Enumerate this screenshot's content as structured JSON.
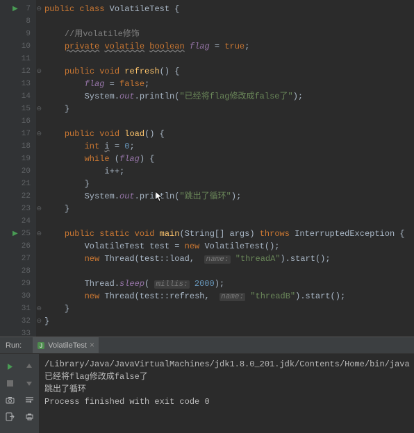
{
  "editor": {
    "lines": [
      {
        "n": 7,
        "run": true,
        "fold": "-"
      },
      {
        "n": 8
      },
      {
        "n": 9
      },
      {
        "n": 10
      },
      {
        "n": 11
      },
      {
        "n": 12,
        "fold": "-"
      },
      {
        "n": 13
      },
      {
        "n": 14
      },
      {
        "n": 15,
        "fold": "e"
      },
      {
        "n": 16
      },
      {
        "n": 17,
        "fold": "-"
      },
      {
        "n": 18
      },
      {
        "n": 19
      },
      {
        "n": 20
      },
      {
        "n": 21
      },
      {
        "n": 22
      },
      {
        "n": 23,
        "fold": "e"
      },
      {
        "n": 24
      },
      {
        "n": 25,
        "run": true,
        "fold": "-"
      },
      {
        "n": 26
      },
      {
        "n": 27
      },
      {
        "n": 28
      },
      {
        "n": 29
      },
      {
        "n": 30
      },
      {
        "n": 31,
        "fold": "e"
      },
      {
        "n": 32,
        "fold": "e"
      },
      {
        "n": 33
      }
    ],
    "tokens": {
      "public": "public",
      "class": "class",
      "className": "VolatileTest",
      "lb": "{",
      "rb": "}",
      "comment9": "//用volatile修饰",
      "private": "private",
      "volatile": "volatile",
      "boolean": "boolean",
      "flag": "flag",
      "eq": " = ",
      "true": "true",
      "semi": ";",
      "void": "void",
      "refresh": "refresh",
      "lp": "(",
      "rp": ")",
      "false": "false",
      "System": "System",
      "out": "out",
      "println": "println",
      "dot": ".",
      "str14": "\"已经将flag修改成false了\"",
      "load": "load",
      "int": "int",
      "i": "i",
      "zero": "0",
      "while": "while",
      "ipp": "i++;",
      "str22": "\"跳出了循环\"",
      "static": "static",
      "main": "main",
      "StringArr": "String[]",
      "args": "args",
      "throws": "throws",
      "IE": "InterruptedException",
      "test": "test",
      "new": "new",
      "Thread": "Thread",
      "dcolon": "::",
      "start": "start",
      "sleep": "sleep",
      "hint_name": "name:",
      "threadA": "\"threadA\"",
      "threadB": "\"threadB\"",
      "hint_millis": "millis:",
      "ms": "2000"
    }
  },
  "run": {
    "label": "Run:",
    "tabTitle": "VolatileTest",
    "tabClose": "×",
    "console": {
      "cmd": "/Library/Java/JavaVirtualMachines/jdk1.8.0_201.jdk/Contents/Home/bin/java ..",
      "out1": "已经将flag修改成false了",
      "out2": "跳出了循环",
      "blank": "",
      "exit": "Process finished with exit code 0"
    }
  }
}
